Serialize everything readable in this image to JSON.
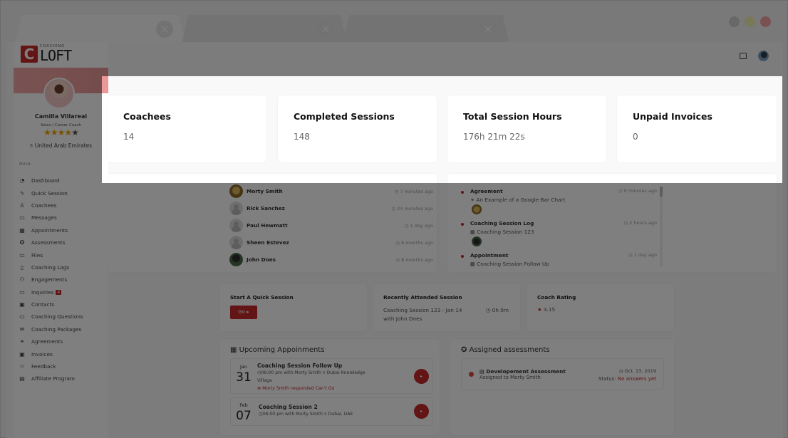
{
  "browser": {
    "tabs": [
      {
        "label": "",
        "close_icon": "×",
        "active": true
      },
      {
        "label": "",
        "close_icon": "×",
        "active": false
      },
      {
        "label": "",
        "close_icon": "×",
        "active": false
      }
    ],
    "window_controls": [
      "minimize",
      "maximize",
      "close"
    ]
  },
  "brand": {
    "mark": "C",
    "small": "COACHING",
    "big": "LOFT",
    "accent": "#c62828"
  },
  "profile": {
    "name": "Camilla Villareal",
    "role": "Sales / Career Coach",
    "rating_stars": 4.5,
    "stars_full": "★★★★",
    "stars_half": "★",
    "location": "United Arab Emirates"
  },
  "sidebar": {
    "section": "MAIN",
    "items": [
      {
        "label": "Dashboard",
        "icon": "◔"
      },
      {
        "label": "Quick Session",
        "icon": "ϟ"
      },
      {
        "label": "Coachees",
        "icon": "♙"
      },
      {
        "label": "Messages",
        "icon": "▭"
      },
      {
        "label": "Appointments",
        "icon": "▦"
      },
      {
        "label": "Assessments",
        "icon": "✪"
      },
      {
        "label": "Files",
        "icon": "▭"
      },
      {
        "label": "Coaching Logs",
        "icon": "▯"
      },
      {
        "label": "Engagements",
        "icon": "⚇"
      },
      {
        "label": "Inquiries",
        "icon": "▭",
        "badge": "4"
      },
      {
        "label": "Contacts",
        "icon": "▣"
      },
      {
        "label": "Coaching Questions",
        "icon": "▭"
      },
      {
        "label": "Coaching Packages",
        "icon": "✉"
      },
      {
        "label": "Agreements",
        "icon": "⚭"
      },
      {
        "label": "Invoices",
        "icon": "▣"
      },
      {
        "label": "Feedback",
        "icon": "☆"
      },
      {
        "label": "Affiliate Program",
        "icon": "▤"
      }
    ]
  },
  "stats": [
    {
      "title": "Coachees",
      "value": "14"
    },
    {
      "title": "Completed Sessions",
      "value": "148"
    },
    {
      "title": "Total Session Hours",
      "value": "176h 21m 22s"
    },
    {
      "title": "Unpaid Invoices",
      "value": "0"
    }
  ],
  "recent_coachees": [
    {
      "name": "Morty Smith",
      "ago": "◷ 7 minutes ago",
      "avatar": "photo"
    },
    {
      "name": "Rick Sanchez",
      "ago": "◷ 24 minutes ago",
      "avatar": "placeholder"
    },
    {
      "name": "Paul Hewmatt",
      "ago": "◷ 1 day ago",
      "avatar": "placeholder"
    },
    {
      "name": "Sheen Estevez",
      "ago": "◷ 6 months ago",
      "avatar": "placeholder"
    },
    {
      "name": "John Does",
      "ago": "◷ 8 months ago",
      "avatar": "photo"
    }
  ],
  "activity": [
    {
      "title": "Agreement",
      "sub": "⚭ An Example of a Google Bar Chart",
      "time": "◷ 9 minutes ago"
    },
    {
      "title": "Coaching Session Log",
      "sub": "▦ Coaching Session 123",
      "time": "◷ 2 hours ago"
    },
    {
      "title": "Appointment",
      "sub": "▦ Coaching Session Follow Up",
      "time": "◷ 1 day ago"
    }
  ],
  "quick_session": {
    "title": "Start A Quick Session",
    "button": "Go ▸"
  },
  "recent_session": {
    "title": "Recently Attended Session",
    "line1": "Coaching Session 123 - Jan 14",
    "line2": "with John Does",
    "duration": "◷ 0h 0m"
  },
  "coach_rating": {
    "title": "Coach Rating",
    "star": "★",
    "value": "3.15"
  },
  "upcoming": {
    "title": "Upcoming Appoinments",
    "icon": "▦",
    "items": [
      {
        "month": "Jan",
        "day": "31",
        "title": "Coaching Session Follow Up",
        "meta": "◷06:00 pm with Morty Smith ⌾ Dubai Knowledge Village",
        "warning": "⊗ Morty Smith responded Can't Go",
        "play": "▸"
      },
      {
        "month": "Feb",
        "day": "07",
        "title": "Coaching Session 2",
        "meta": "◷06:00 pm with Morty Smith ⌾ Dubai, UAE",
        "play": "▸"
      }
    ]
  },
  "assessments": {
    "title": "Assigned assessments",
    "icon": "✪",
    "items": [
      {
        "name": "▤ Developement Assessment",
        "assigned": "Assigned to Morty Smith",
        "date": "◷ Oct. 13, 2019",
        "status_label": "Status:",
        "status_value": "No answers yet"
      }
    ]
  }
}
